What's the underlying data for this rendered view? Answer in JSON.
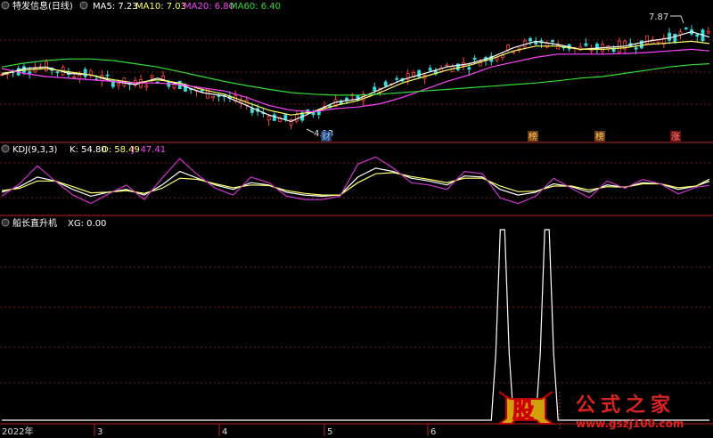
{
  "panes": {
    "price": {
      "stock_name": "特发信息(日线)",
      "indicators": [
        {
          "label": "MA5: 7.23",
          "color": "#ffffff"
        },
        {
          "label": "MA10: 7.03",
          "color": "#ffff66"
        },
        {
          "label": "MA20: 6.80",
          "color": "#ff44ff"
        },
        {
          "label": "MA60: 6.40",
          "color": "#33dd33"
        }
      ],
      "high_label": "7.87",
      "low_label": "4.13",
      "event_markers": [
        "财",
        "榜",
        "榜",
        "涨"
      ]
    },
    "kdj": {
      "title": "KDJ(9,3,3)",
      "indicators": [
        {
          "label": "K: 54.80",
          "color": "#ffffff"
        },
        {
          "label": "D: 58.49",
          "color": "#ffff66"
        },
        {
          "label": "J: 47.41",
          "color": "#ff44ff"
        }
      ]
    },
    "signal": {
      "title": "船长直升机",
      "indicators": [
        {
          "label": "XG: 0.00",
          "color": "#ffffff"
        }
      ]
    }
  },
  "x_axis": {
    "labels": [
      "2022年",
      "3",
      "4",
      "5",
      "6"
    ]
  },
  "watermark": {
    "logo_char": "股",
    "text": "公式之家",
    "url": "www.gszj100.com"
  },
  "chart_data": [
    {
      "type": "line",
      "name": "price-pane",
      "x": [
        0,
        5,
        10,
        15,
        20,
        25,
        30,
        35,
        40,
        45,
        50,
        55,
        60,
        65,
        70,
        75,
        80,
        85,
        90,
        95,
        100,
        105,
        110,
        115,
        120,
        125,
        130,
        135,
        140,
        145,
        150,
        155,
        159
      ],
      "series": [
        {
          "name": "MA5",
          "values": [
            6.05,
            6.25,
            6.3,
            6.1,
            6.05,
            5.85,
            5.75,
            5.95,
            5.75,
            5.5,
            5.4,
            5.1,
            4.8,
            4.6,
            4.9,
            5.2,
            5.3,
            5.6,
            5.9,
            6.1,
            6.3,
            6.4,
            6.6,
            6.9,
            7.1,
            7.0,
            6.85,
            6.9,
            6.95,
            7.1,
            7.2,
            7.4,
            7.23
          ]
        },
        {
          "name": "MA10",
          "values": [
            6.1,
            6.2,
            6.25,
            6.15,
            6.05,
            5.9,
            5.8,
            5.9,
            5.8,
            5.6,
            5.45,
            5.2,
            4.95,
            4.8,
            4.9,
            5.1,
            5.25,
            5.5,
            5.8,
            6.0,
            6.2,
            6.35,
            6.55,
            6.8,
            6.95,
            6.95,
            6.85,
            6.85,
            6.9,
            7.0,
            7.05,
            7.1,
            7.03
          ]
        },
        {
          "name": "MA20",
          "values": [
            6.25,
            6.1,
            6.0,
            5.95,
            5.9,
            5.85,
            5.8,
            5.8,
            5.75,
            5.65,
            5.55,
            5.35,
            5.1,
            4.95,
            4.9,
            5.0,
            5.05,
            5.15,
            5.35,
            5.6,
            5.85,
            6.05,
            6.3,
            6.45,
            6.6,
            6.7,
            6.7,
            6.7,
            6.72,
            6.75,
            6.8,
            6.85,
            6.8
          ]
        },
        {
          "name": "MA60",
          "values": [
            6.3,
            6.42,
            6.5,
            6.55,
            6.55,
            6.5,
            6.4,
            6.3,
            6.15,
            6.0,
            5.85,
            5.72,
            5.6,
            5.5,
            5.45,
            5.42,
            5.42,
            5.45,
            5.5,
            5.55,
            5.6,
            5.65,
            5.7,
            5.75,
            5.8,
            5.87,
            5.95,
            6.0,
            6.1,
            6.2,
            6.3,
            6.37,
            6.4
          ]
        }
      ],
      "ylim": [
        4.0,
        8.0
      ]
    },
    {
      "type": "line",
      "name": "kdj-pane",
      "x": [
        0,
        4,
        8,
        12,
        16,
        20,
        24,
        28,
        32,
        36,
        40,
        44,
        48,
        52,
        56,
        60,
        64,
        68,
        72,
        76,
        80,
        84,
        88,
        92,
        96,
        100,
        104,
        108,
        112,
        116,
        120,
        124,
        128,
        132,
        136,
        140,
        144,
        148,
        152,
        156,
        159
      ],
      "series": [
        {
          "name": "K",
          "values": [
            35,
            45,
            62,
            55,
            40,
            28,
            35,
            40,
            30,
            48,
            72,
            60,
            48,
            40,
            52,
            48,
            35,
            30,
            28,
            30,
            62,
            78,
            72,
            60,
            55,
            48,
            64,
            62,
            40,
            30,
            35,
            50,
            45,
            35,
            48,
            44,
            52,
            50,
            40,
            46,
            54.8
          ]
        },
        {
          "name": "D",
          "values": [
            38,
            42,
            55,
            55,
            45,
            34,
            35,
            38,
            33,
            42,
            60,
            58,
            50,
            43,
            48,
            47,
            38,
            33,
            30,
            30,
            52,
            68,
            70,
            63,
            58,
            52,
            60,
            60,
            46,
            36,
            37,
            46,
            46,
            39,
            45,
            44,
            50,
            50,
            43,
            46,
            58.49
          ]
        },
        {
          "name": "J",
          "values": [
            28,
            50,
            82,
            55,
            30,
            15,
            32,
            48,
            22,
            60,
            95,
            66,
            42,
            30,
            62,
            52,
            28,
            22,
            22,
            28,
            85,
            98,
            78,
            52,
            48,
            40,
            72,
            68,
            25,
            15,
            28,
            60,
            42,
            25,
            55,
            42,
            58,
            50,
            32,
            44,
            47.41
          ]
        }
      ],
      "ylim": [
        0,
        100
      ]
    },
    {
      "type": "line",
      "name": "signal-pane",
      "x": [
        0,
        20,
        40,
        60,
        80,
        100,
        110,
        111,
        112,
        113,
        114,
        115,
        120,
        121,
        122,
        123,
        124,
        125,
        130,
        159
      ],
      "series": [
        {
          "name": "XG",
          "values": [
            0,
            0,
            0,
            0,
            0,
            0,
            0,
            0.35,
            1,
            1,
            0.35,
            0,
            0,
            0.35,
            1,
            1,
            0.35,
            0,
            0,
            0
          ]
        }
      ],
      "ylim": [
        0,
        1
      ]
    }
  ]
}
